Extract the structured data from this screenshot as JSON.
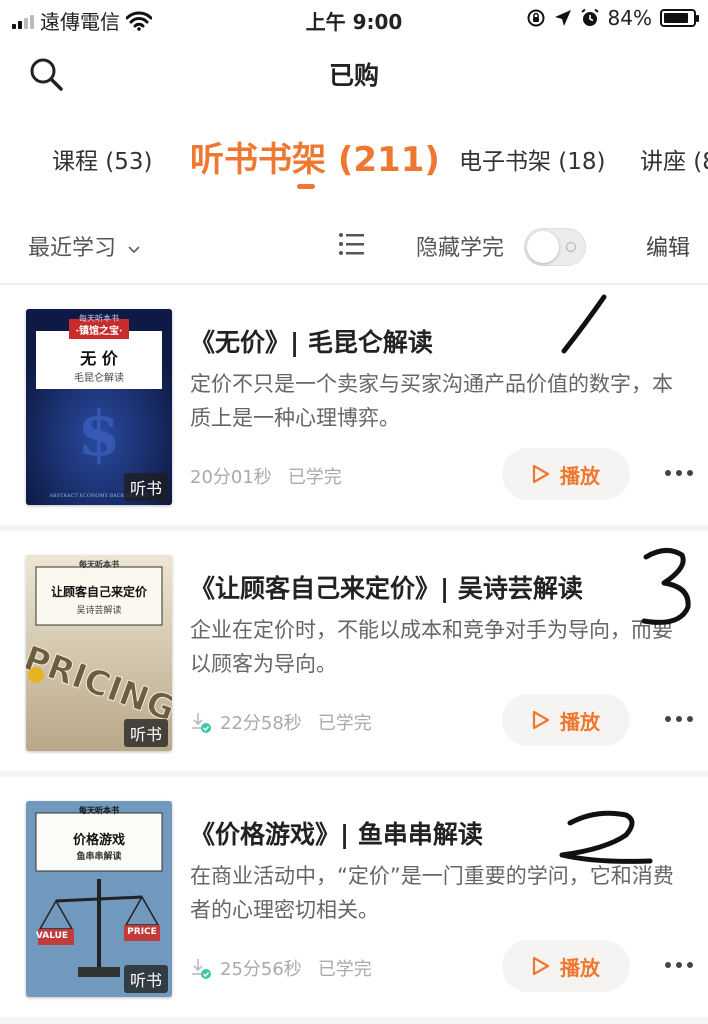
{
  "status_bar": {
    "carrier": "遠傳電信",
    "time": "上午 9:00",
    "battery": "84%",
    "battery_level": 0.84
  },
  "nav": {
    "title": "已购",
    "search_icon": "search-icon"
  },
  "tabs": [
    {
      "label": "课程 (53)",
      "active": false
    },
    {
      "label": "听书书架 (211)",
      "active": true
    },
    {
      "label": "电子书架 (18)",
      "active": false
    },
    {
      "label": "讲座 (8",
      "active": false
    }
  ],
  "filter": {
    "sort_label": "最近学习",
    "hide_label": "隐藏学完",
    "hide_enabled": false,
    "edit_label": "编辑"
  },
  "books": [
    {
      "title": "《无价》| 毛昆仑解读",
      "description": "定价不只是一个卖家与买家沟通产品价值的数字，本质上是一种心理博弈。",
      "duration": "20分01秒",
      "status": "已学完",
      "downloaded": false,
      "play_label": "播放",
      "badge": "听书",
      "cover": {
        "series": "每天听本书",
        "ribbon": "·镇馆之宝·",
        "title": "无 价",
        "author": "毛昆仑解读",
        "footer": "ABSTRACT ECONOMY BACKGROUND"
      },
      "annotation": "/"
    },
    {
      "title": "《让顾客自己来定价》| 吴诗芸解读",
      "description": "企业在定价时，不能以成本和竞争对手为导向，而要以顾客为导向。",
      "duration": "22分58秒",
      "status": "已学完",
      "downloaded": true,
      "play_label": "播放",
      "badge": "听书",
      "cover": {
        "series": "每天听本书",
        "title": "让顾客自己来定价",
        "author": "吴诗芸解读",
        "art_word": "PRICING"
      },
      "annotation": "3"
    },
    {
      "title": "《价格游戏》| 鱼串串解读",
      "description": "在商业活动中，“定价”是一门重要的学问，它和消费者的心理密切相关。",
      "duration": "25分56秒",
      "status": "已学完",
      "downloaded": true,
      "play_label": "播放",
      "badge": "听书",
      "cover": {
        "series": "每天听本书",
        "title": "价格游戏",
        "author": "鱼串串解读",
        "left_pan": "VALUE",
        "right_pan": "PRICE"
      },
      "annotation": "2"
    }
  ],
  "colors": {
    "accent": "#f0772f",
    "background": "#f4f4f4"
  }
}
